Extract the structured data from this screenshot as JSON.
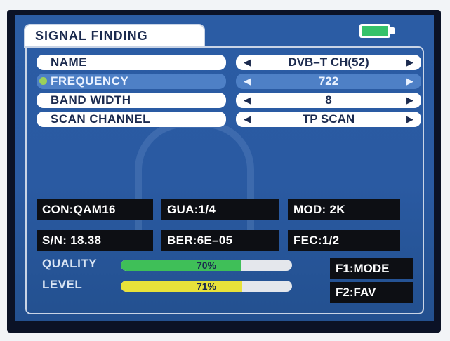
{
  "title": "SIGNAL FINDING",
  "battery": {
    "level": 1.0,
    "color": "#35c26a"
  },
  "rows": [
    {
      "label": "NAME",
      "value": "DVB–T CH(52)",
      "selected": false
    },
    {
      "label": "FREQUENCY",
      "value": "722",
      "selected": true
    },
    {
      "label": "BAND WIDTH",
      "value": "8",
      "selected": false
    },
    {
      "label": "SCAN CHANNEL",
      "value": "TP SCAN",
      "selected": false
    }
  ],
  "info": {
    "con": "CON:QAM16",
    "gua": "GUA:1/4",
    "mod": "MOD: 2K",
    "sn": "S/N: 18.38",
    "ber": "BER:6E–05",
    "fec": "FEC:1/2"
  },
  "quality": {
    "label": "QUALITY",
    "percent": 70,
    "percent_text": "70%",
    "color": "#3fbf58"
  },
  "level": {
    "label": "LEVEL",
    "percent": 71,
    "percent_text": "71%",
    "color": "#e8e23a"
  },
  "function_keys": {
    "f1": "F1:MODE",
    "f2": "F2:FAV"
  },
  "colors": {
    "screen_bg": "#2b5ca4",
    "selected_row": "#4e80c6",
    "info_box": "#0d0f14"
  }
}
